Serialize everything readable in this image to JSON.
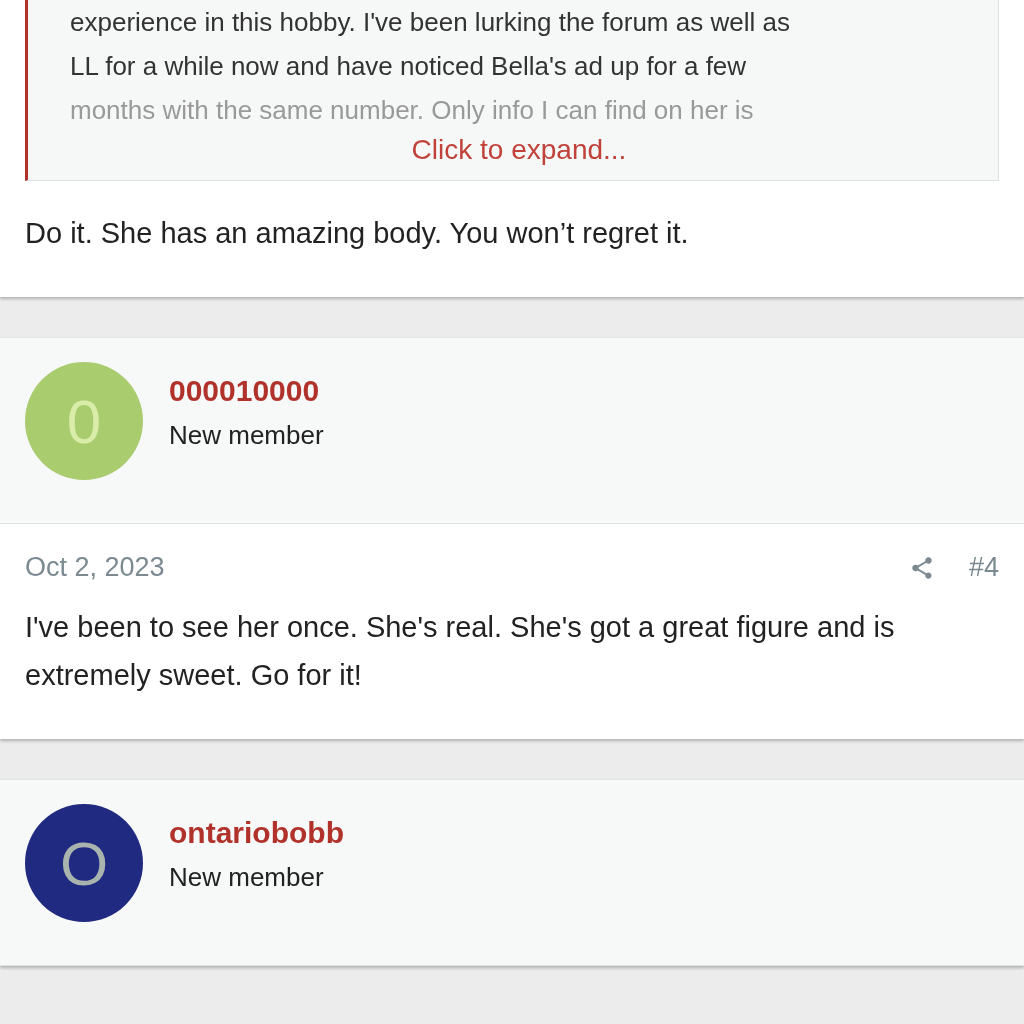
{
  "posts": [
    {
      "quote": {
        "lines": [
          "experience in this hobby. I've been lurking the forum as well as",
          "LL for a while now and have noticed Bella's ad up for a few",
          "months with the same number. Only info I can find on her is"
        ],
        "expand_label": "Click to expand..."
      },
      "body": "Do it. She has an amazing body. You won’t regret it."
    },
    {
      "author": {
        "name": "000010000",
        "role": "New member",
        "initial": "0",
        "color": "#a8cc6e"
      },
      "date": "Oct 2, 2023",
      "number": "#4",
      "body": "I've been to see her once. She's real. She's got a great figure and is extremely sweet. Go for it!"
    },
    {
      "author": {
        "name": "ontariobobb",
        "role": "New member",
        "initial": "O",
        "color": "#1f2a80"
      }
    }
  ]
}
